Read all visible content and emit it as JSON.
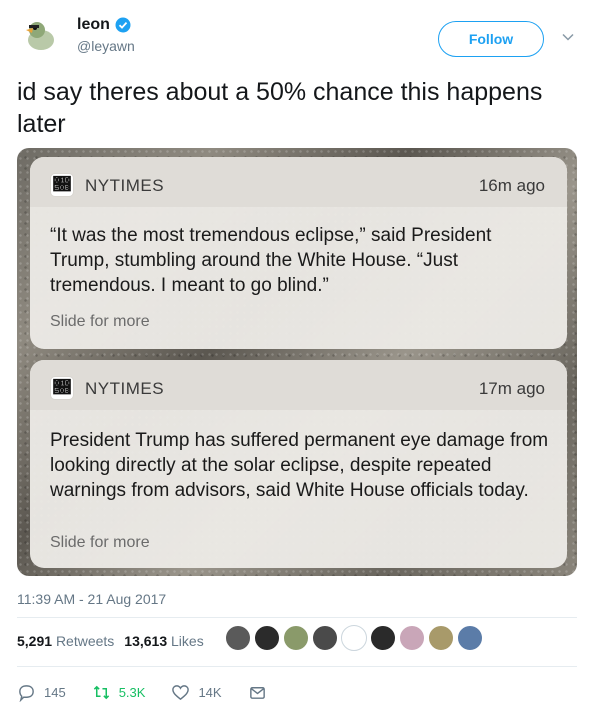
{
  "user": {
    "display_name": "leon",
    "handle": "@leyawn",
    "avatar_icon": "duck-avatar-icon",
    "verified": true
  },
  "follow_label": "Follow",
  "tweet_text": "id say theres about a 50% chance this happens later",
  "notifications": [
    {
      "app_name": "NYTIMES",
      "time_ago": "16m ago",
      "body": "“It was the most tremendous eclipse,” said President Trump, stumbling around the White House. “Just tremendous. I meant to go blind.”",
      "slide_hint": "Slide for more"
    },
    {
      "app_name": "NYTIMES",
      "time_ago": "17m ago",
      "body": "President Trump has suffered permanent eye damage from looking directly at the solar eclipse, despite repeated warnings from advisors, said White House officials today.",
      "slide_hint": "Slide for more"
    }
  ],
  "timestamp": "11:39 AM - 21 Aug 2017",
  "stats": {
    "retweets_count": "5,291",
    "retweets_label": "Retweets",
    "likes_count": "13,613",
    "likes_label": "Likes"
  },
  "liker_avatar_colors": [
    "#5a5a5a",
    "#2b2b2b",
    "#8a9a6a",
    "#4a4a4a",
    "#ffffff",
    "#2a2a2a",
    "#c9a6b8",
    "#a89a6a",
    "#5b7ca8"
  ],
  "actions": {
    "reply_count": "145",
    "retweet_count": "5.3K",
    "like_count": "14K"
  },
  "colors": {
    "accent": "#1da1f2",
    "muted": "#657786",
    "retweet": "#17bf63"
  }
}
